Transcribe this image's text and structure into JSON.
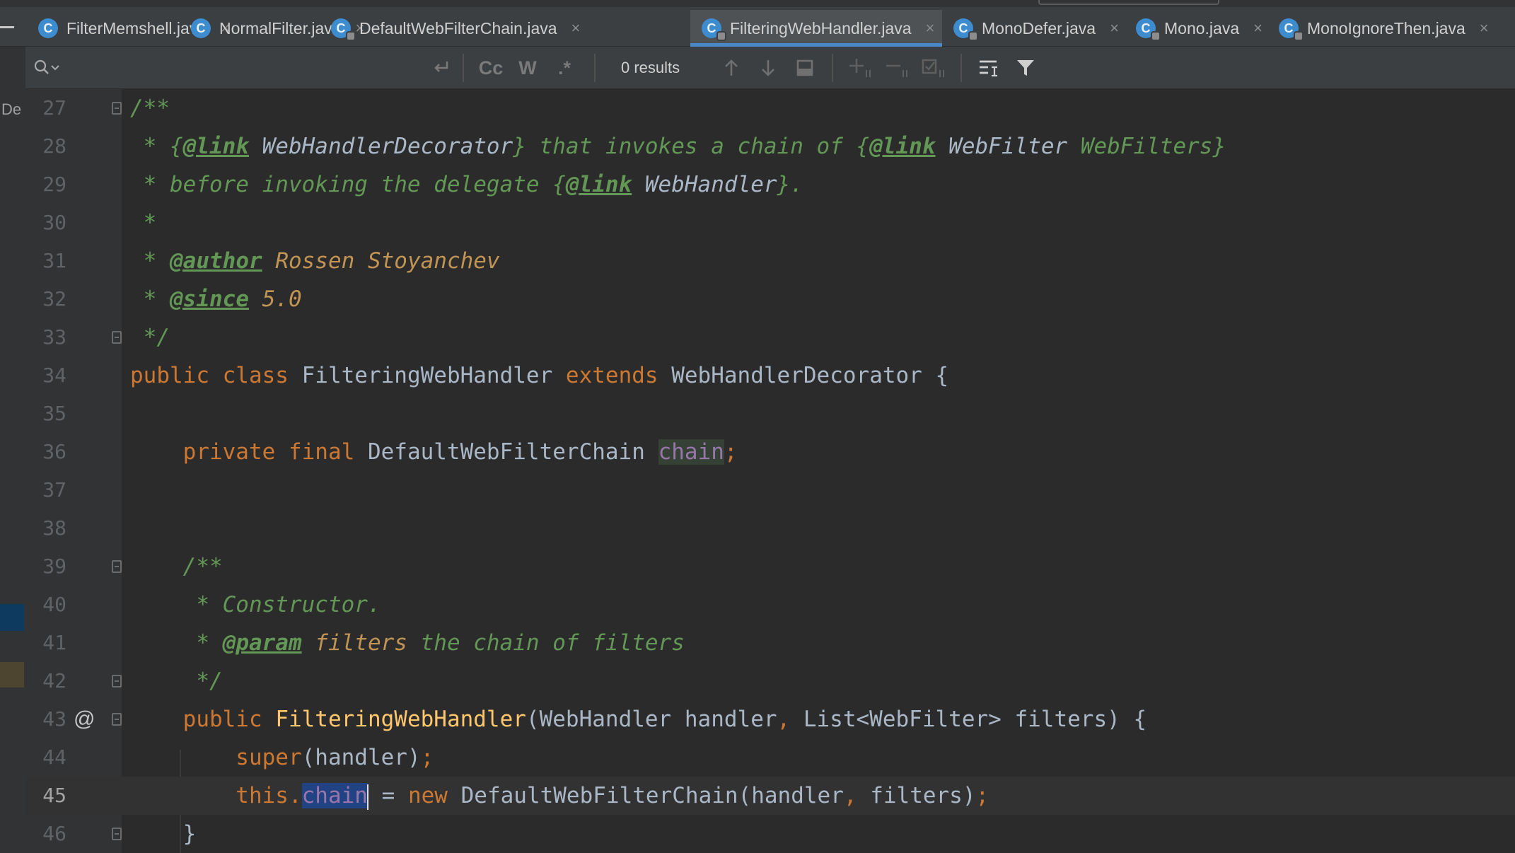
{
  "tabs": [
    {
      "label": "FilterMemshell.java",
      "locked": false,
      "active": false
    },
    {
      "label": "NormalFilter.java",
      "locked": false,
      "active": false
    },
    {
      "label": "DefaultWebFilterChain.java",
      "locked": true,
      "active": false
    },
    {
      "label": "FilteringWebHandler.java",
      "locked": true,
      "active": true
    },
    {
      "label": "MonoDefer.java",
      "locked": true,
      "active": false
    },
    {
      "label": "Mono.java",
      "locked": true,
      "active": false
    },
    {
      "label": "MonoIgnoreThen.java",
      "locked": true,
      "active": false
    }
  ],
  "tab_icon_letter": "C",
  "tab_close_glyph": "×",
  "find": {
    "placeholder": "",
    "results": "0 results",
    "match_case": "Cc",
    "words": "W",
    "regex": ".*"
  },
  "left_strip_label": "De",
  "gutter": {
    "override_marker": "@"
  },
  "lines": {
    "l27": {
      "n": "27",
      "t": "/**"
    },
    "l28": {
      "n": "28",
      "a": " * {",
      "b": "@link",
      "c": " WebHandlerDecorator",
      "d": "} that invokes a chain of {",
      "e": "@link",
      "f": " WebFilter",
      "g": " WebFilters}"
    },
    "l29": {
      "n": "29",
      "a": " * before invoking the delegate {",
      "b": "@link",
      "c": " WebHandler",
      "d": "}."
    },
    "l30": {
      "n": "30",
      "t": " *"
    },
    "l31": {
      "n": "31",
      "a": " * ",
      "b": "@author",
      "c": " Rossen Stoyanchev"
    },
    "l32": {
      "n": "32",
      "a": " * ",
      "b": "@since",
      "c": " 5.0"
    },
    "l33": {
      "n": "33",
      "t": " */"
    },
    "l34": {
      "n": "34",
      "a": "public class ",
      "b": "FilteringWebHandler ",
      "c": "extends ",
      "d": "WebHandlerDecorator {"
    },
    "l35": {
      "n": "35"
    },
    "l36": {
      "n": "36",
      "a": "    private final ",
      "b": "DefaultWebFilterChain ",
      "c": "chain",
      "d": ";"
    },
    "l37": {
      "n": "37"
    },
    "l38": {
      "n": "38"
    },
    "l39": {
      "n": "39",
      "t": "    /**"
    },
    "l40": {
      "n": "40",
      "t": "     * Constructor."
    },
    "l41": {
      "n": "41",
      "a": "     * ",
      "b": "@param",
      "c": " filters",
      "d": " the chain of filters"
    },
    "l42": {
      "n": "42",
      "t": "     */"
    },
    "l43": {
      "n": "43",
      "a": "    public ",
      "b": "FilteringWebHandler",
      "c": "(WebHandler handler",
      "d": ", ",
      "e": "List<WebFilter> filters) {"
    },
    "l44": {
      "n": "44",
      "a": "        super",
      "b": "(handler)",
      "c": ";"
    },
    "l45": {
      "n": "45",
      "a": "        this.",
      "b": "chain",
      "c": " = ",
      "d": "new ",
      "e": "DefaultWebFilterChain(handler",
      "f": ", ",
      "g": "filters)",
      "h": ";"
    },
    "l46": {
      "n": "46",
      "t": "    }"
    }
  },
  "colors": {
    "keyword": "#cc7832",
    "field": "#9876aa",
    "method": "#ffc66d",
    "doc_comment": "#629755",
    "selection": "#214283",
    "active_tab_underline": "#4a88c7"
  }
}
